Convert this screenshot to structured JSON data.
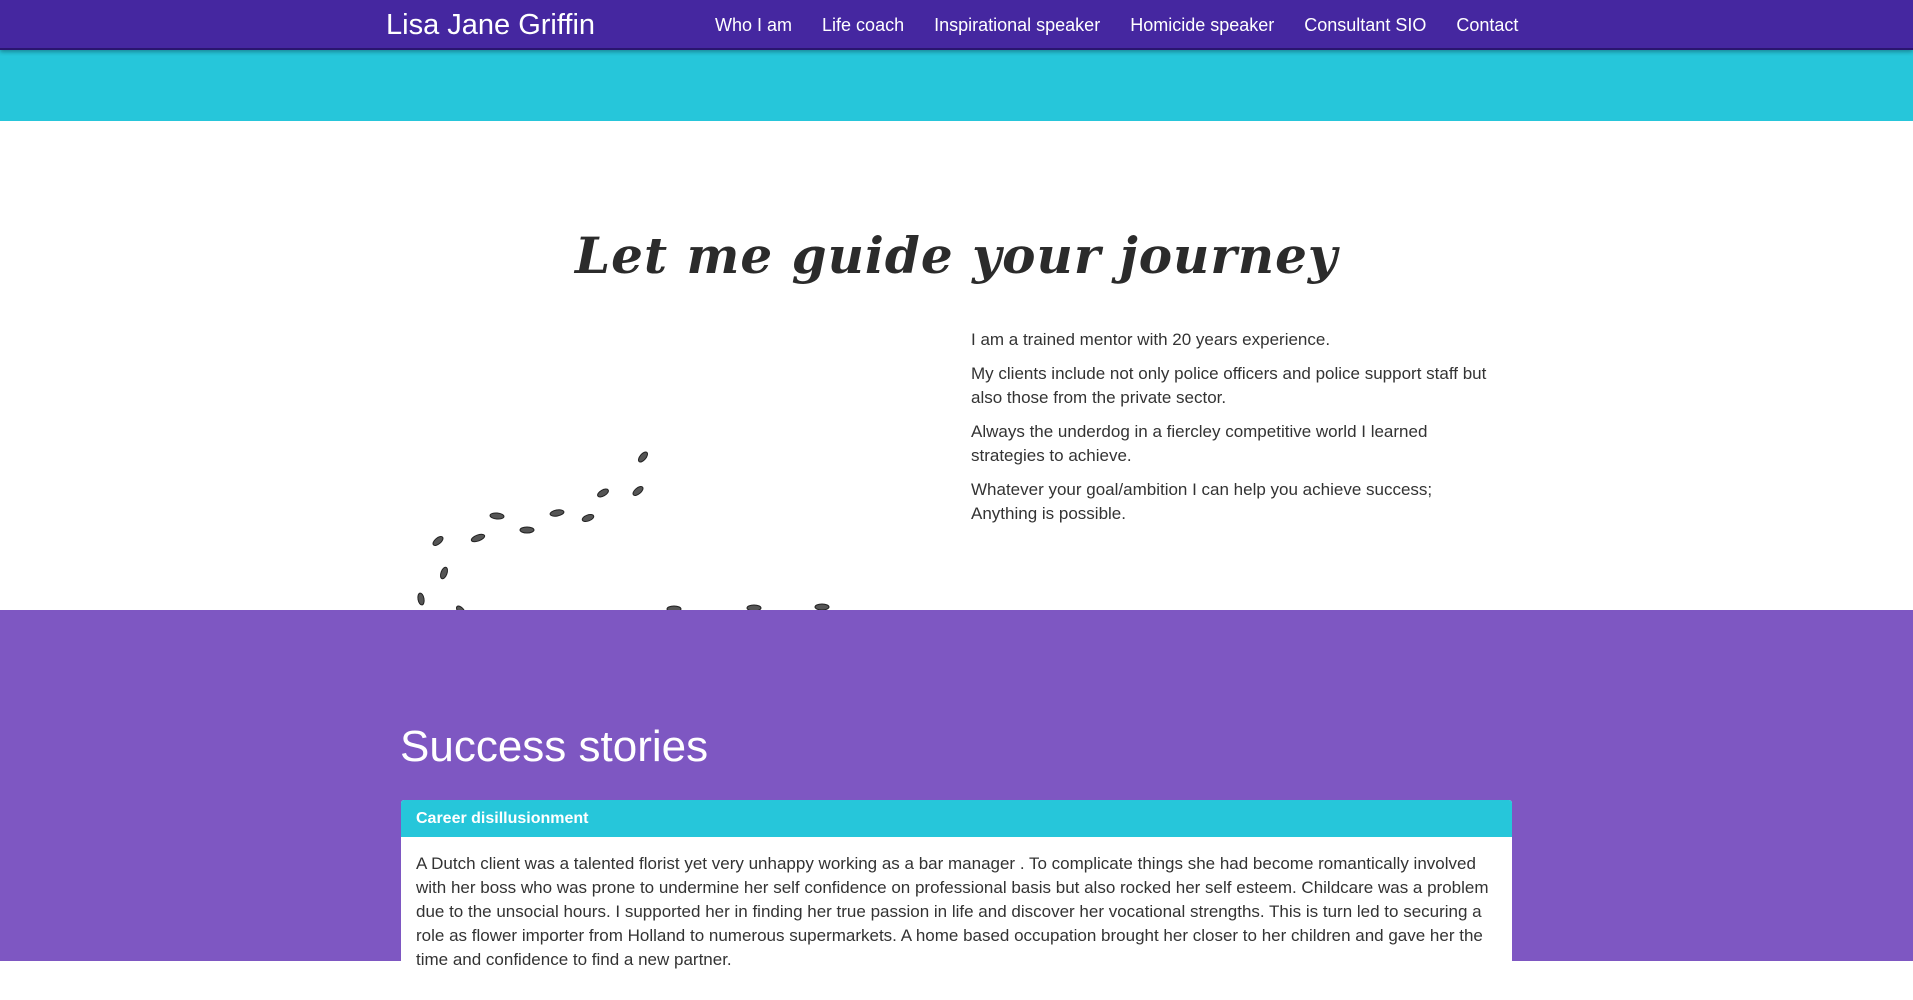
{
  "header": {
    "brand": "Lisa Jane Griffin",
    "nav": [
      {
        "label": "Who I am"
      },
      {
        "label": "Life coach"
      },
      {
        "label": "Inspirational speaker"
      },
      {
        "label": "Homicide speaker"
      },
      {
        "label": "Consultant SIO"
      },
      {
        "label": "Contact"
      }
    ]
  },
  "intro": {
    "title": "Let me guide your journey",
    "paragraphs": [
      "I am a trained mentor with 20 years experience.",
      "My clients include not only police officers and police support staff but also those from the private sector.",
      "Always the underdog in a fiercley competitive world I learned strategies to achieve.",
      "Whatever your goal/ambition I can help you achieve success; Anything is possible."
    ]
  },
  "stories": {
    "title": "Success stories",
    "panel_heading": "Career disillusionment",
    "panel_body": "A Dutch client was a talented florist yet very unhappy working as a bar manager . To complicate things she had become romantically involved with her boss who was prone to undermine her self confidence on professional basis but also rocked her self esteem. Childcare was a problem due to the unsocial hours. I supported her in finding her true passion in life and discover her vocational strengths. This is turn led to securing a role as flower importer from Holland to numerous supermarkets. A home based occupation brought her closer to her children and gave her the time and confidence to find a new partner."
  },
  "colors": {
    "navbar": "#4527a0",
    "teal": "#26c6da",
    "purple": "#7e57c2"
  }
}
